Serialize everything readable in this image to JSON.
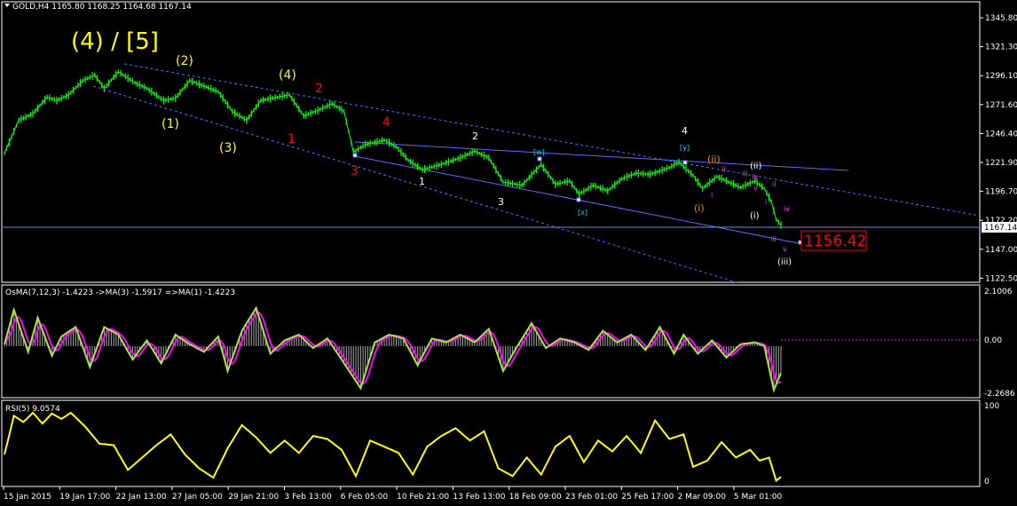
{
  "colors": {
    "background": "#000000",
    "frame": "#ffffff",
    "bull_candle": "#00ff00",
    "bear_candle": "#00ff00",
    "channel": "#5a6bff",
    "osma_hist": "#b4b4b4",
    "osma_fast": "#a7e34a",
    "osma_slow": "#ff00ff",
    "rsi": "#ffff00",
    "price_line": "#6f8fd6",
    "target_box": "#ff0000",
    "wave_yellow": "#ffff00",
    "wave_red": "#ff0000",
    "wave_white": "#ffffff",
    "wave_orange": "#ff8c00",
    "wave_cyan": "#00d5ff",
    "wave_magenta": "#ff33ff"
  },
  "main": {
    "title": "GOLD,H4  1165.80 1168.25 1164.68 1167.14",
    "price_axis": [
      "1345.80",
      "1321.30",
      "1296.10",
      "1271.60",
      "1246.40",
      "1221.90",
      "1196.70",
      "1172.20",
      "1147.00",
      "1122.50"
    ],
    "current_price": "1167.14",
    "target_label": "1156.42",
    "wave_labels": {
      "big": "(4) / [5]",
      "w1": "(1)",
      "w2": "(2)",
      "w3": "(3)",
      "w4": "(4)",
      "r1": "1",
      "r2": "2",
      "r3": "3",
      "r4": "4",
      "n1": "1",
      "n2": "2",
      "n3": "3",
      "n4": "4",
      "cw": "[w]",
      "cx": "[x]",
      "cy": "[y]",
      "oi": "(i)",
      "oii": "(ii)",
      "mi": "i",
      "mii": "ii",
      "miii": "iii",
      "miv": "iv",
      "mv": "v",
      "wi": "(i)",
      "wii": "(ii)",
      "wiii": "(iii)",
      "si": "i",
      "sii": "ii",
      "siii": "iii",
      "siv": "iv",
      "sv": "v"
    }
  },
  "osma": {
    "title": "OsMA(7,12,3) -1.4223  ->MA(3) -1.5917  =>MA(1) -1.4223",
    "axis": [
      "2.1006",
      "0.00",
      "-2.2686"
    ]
  },
  "rsi": {
    "title": "RSI(5) 9.0574",
    "axis": [
      "100",
      "0"
    ]
  },
  "time_axis": [
    "15 Jan 2015",
    "19 Jan 17:00",
    "22 Jan 13:00",
    "27 Jan 05:00",
    "29 Jan 21:00",
    "3 Feb 13:00",
    "6 Feb 05:00",
    "10 Feb 21:00",
    "13 Feb 13:00",
    "18 Feb 09:00",
    "23 Feb 01:00",
    "25 Feb 17:00",
    "2 Mar 09:00",
    "5 Mar 01:00"
  ],
  "chart_data": {
    "type": "line",
    "symbol": "GOLD",
    "timeframe": "H4",
    "ohlc_last": {
      "open": 1165.8,
      "high": 1168.25,
      "low": 1164.68,
      "close": 1167.14
    },
    "ylim": [
      1115,
      1355
    ],
    "close_path": [
      {
        "i": 0,
        "v": 1232
      },
      {
        "i": 6,
        "v": 1262
      },
      {
        "i": 12,
        "v": 1268
      },
      {
        "i": 18,
        "v": 1283
      },
      {
        "i": 22,
        "v": 1280
      },
      {
        "i": 27,
        "v": 1285
      },
      {
        "i": 33,
        "v": 1298
      },
      {
        "i": 38,
        "v": 1303
      },
      {
        "i": 42,
        "v": 1291
      },
      {
        "i": 48,
        "v": 1306
      },
      {
        "i": 55,
        "v": 1296
      },
      {
        "i": 60,
        "v": 1291
      },
      {
        "i": 67,
        "v": 1280
      },
      {
        "i": 72,
        "v": 1282
      },
      {
        "i": 78,
        "v": 1298
      },
      {
        "i": 84,
        "v": 1293
      },
      {
        "i": 90,
        "v": 1288
      },
      {
        "i": 96,
        "v": 1270
      },
      {
        "i": 102,
        "v": 1262
      },
      {
        "i": 108,
        "v": 1280
      },
      {
        "i": 115,
        "v": 1283
      },
      {
        "i": 120,
        "v": 1285
      },
      {
        "i": 126,
        "v": 1266
      },
      {
        "i": 132,
        "v": 1271
      },
      {
        "i": 138,
        "v": 1277
      },
      {
        "i": 143,
        "v": 1270
      },
      {
        "i": 147,
        "v": 1233
      },
      {
        "i": 152,
        "v": 1240
      },
      {
        "i": 160,
        "v": 1244
      },
      {
        "i": 165,
        "v": 1238
      },
      {
        "i": 170,
        "v": 1226
      },
      {
        "i": 176,
        "v": 1217
      },
      {
        "i": 184,
        "v": 1222
      },
      {
        "i": 192,
        "v": 1228
      },
      {
        "i": 198,
        "v": 1234
      },
      {
        "i": 204,
        "v": 1228
      },
      {
        "i": 210,
        "v": 1206
      },
      {
        "i": 218,
        "v": 1203
      },
      {
        "i": 226,
        "v": 1222
      },
      {
        "i": 232,
        "v": 1204
      },
      {
        "i": 238,
        "v": 1207
      },
      {
        "i": 242,
        "v": 1195
      },
      {
        "i": 248,
        "v": 1203
      },
      {
        "i": 254,
        "v": 1198
      },
      {
        "i": 260,
        "v": 1209
      },
      {
        "i": 266,
        "v": 1214
      },
      {
        "i": 272,
        "v": 1213
      },
      {
        "i": 280,
        "v": 1219
      },
      {
        "i": 284,
        "v": 1224
      },
      {
        "i": 290,
        "v": 1212
      },
      {
        "i": 294,
        "v": 1200
      },
      {
        "i": 300,
        "v": 1211
      },
      {
        "i": 304,
        "v": 1207
      },
      {
        "i": 310,
        "v": 1201
      },
      {
        "i": 316,
        "v": 1207
      },
      {
        "i": 320,
        "v": 1200
      },
      {
        "i": 323,
        "v": 1188
      },
      {
        "i": 325,
        "v": 1172
      },
      {
        "i": 327,
        "v": 1167
      }
    ],
    "osma_ylim": [
      -2.6,
      2.5
    ],
    "osma_path": [
      {
        "i": 0,
        "v": 0.1
      },
      {
        "i": 4,
        "v": 1.9
      },
      {
        "i": 10,
        "v": -0.3
      },
      {
        "i": 14,
        "v": 1.5
      },
      {
        "i": 20,
        "v": -0.5
      },
      {
        "i": 24,
        "v": 0.5
      },
      {
        "i": 30,
        "v": 1.0
      },
      {
        "i": 36,
        "v": -1.1
      },
      {
        "i": 42,
        "v": 1.0
      },
      {
        "i": 48,
        "v": 0.6
      },
      {
        "i": 54,
        "v": -0.7
      },
      {
        "i": 60,
        "v": 0.3
      },
      {
        "i": 66,
        "v": -0.9
      },
      {
        "i": 72,
        "v": 0.6
      },
      {
        "i": 78,
        "v": 0.1
      },
      {
        "i": 84,
        "v": -0.3
      },
      {
        "i": 90,
        "v": 0.5
      },
      {
        "i": 94,
        "v": -1.3
      },
      {
        "i": 100,
        "v": 0.8
      },
      {
        "i": 106,
        "v": 2.0
      },
      {
        "i": 112,
        "v": -0.4
      },
      {
        "i": 118,
        "v": 0.3
      },
      {
        "i": 124,
        "v": 0.6
      },
      {
        "i": 130,
        "v": -0.1
      },
      {
        "i": 136,
        "v": 0.4
      },
      {
        "i": 142,
        "v": -0.7
      },
      {
        "i": 150,
        "v": -2.2
      },
      {
        "i": 156,
        "v": 0.2
      },
      {
        "i": 162,
        "v": 0.6
      },
      {
        "i": 168,
        "v": 0.4
      },
      {
        "i": 174,
        "v": -1.0
      },
      {
        "i": 180,
        "v": 0.4
      },
      {
        "i": 186,
        "v": 0.2
      },
      {
        "i": 192,
        "v": 0.6
      },
      {
        "i": 198,
        "v": 0.2
      },
      {
        "i": 204,
        "v": 0.9
      },
      {
        "i": 210,
        "v": -1.3
      },
      {
        "i": 216,
        "v": 0.0
      },
      {
        "i": 222,
        "v": 1.2
      },
      {
        "i": 228,
        "v": -0.1
      },
      {
        "i": 234,
        "v": 0.4
      },
      {
        "i": 240,
        "v": 0.2
      },
      {
        "i": 246,
        "v": -0.2
      },
      {
        "i": 252,
        "v": 0.8
      },
      {
        "i": 258,
        "v": 0.2
      },
      {
        "i": 264,
        "v": 0.6
      },
      {
        "i": 270,
        "v": -0.2
      },
      {
        "i": 276,
        "v": 1.0
      },
      {
        "i": 282,
        "v": -0.4
      },
      {
        "i": 286,
        "v": 0.6
      },
      {
        "i": 292,
        "v": -0.4
      },
      {
        "i": 298,
        "v": 0.3
      },
      {
        "i": 304,
        "v": -0.6
      },
      {
        "i": 310,
        "v": 0.1
      },
      {
        "i": 316,
        "v": 0.2
      },
      {
        "i": 320,
        "v": 0.0
      },
      {
        "i": 324,
        "v": -2.3
      },
      {
        "i": 327,
        "v": -1.4
      }
    ],
    "rsi_ylim": [
      0,
      100
    ],
    "rsi_path": [
      {
        "i": 0,
        "v": 38
      },
      {
        "i": 4,
        "v": 88
      },
      {
        "i": 8,
        "v": 80
      },
      {
        "i": 12,
        "v": 92
      },
      {
        "i": 16,
        "v": 78
      },
      {
        "i": 20,
        "v": 91
      },
      {
        "i": 24,
        "v": 84
      },
      {
        "i": 28,
        "v": 92
      },
      {
        "i": 34,
        "v": 74
      },
      {
        "i": 40,
        "v": 52
      },
      {
        "i": 46,
        "v": 50
      },
      {
        "i": 52,
        "v": 18
      },
      {
        "i": 58,
        "v": 34
      },
      {
        "i": 64,
        "v": 50
      },
      {
        "i": 70,
        "v": 64
      },
      {
        "i": 76,
        "v": 38
      },
      {
        "i": 82,
        "v": 20
      },
      {
        "i": 88,
        "v": 8
      },
      {
        "i": 94,
        "v": 46
      },
      {
        "i": 100,
        "v": 76
      },
      {
        "i": 106,
        "v": 60
      },
      {
        "i": 112,
        "v": 40
      },
      {
        "i": 118,
        "v": 56
      },
      {
        "i": 124,
        "v": 40
      },
      {
        "i": 130,
        "v": 62
      },
      {
        "i": 136,
        "v": 58
      },
      {
        "i": 142,
        "v": 44
      },
      {
        "i": 148,
        "v": 10
      },
      {
        "i": 154,
        "v": 56
      },
      {
        "i": 160,
        "v": 48
      },
      {
        "i": 166,
        "v": 40
      },
      {
        "i": 172,
        "v": 12
      },
      {
        "i": 178,
        "v": 48
      },
      {
        "i": 184,
        "v": 62
      },
      {
        "i": 190,
        "v": 72
      },
      {
        "i": 196,
        "v": 56
      },
      {
        "i": 202,
        "v": 68
      },
      {
        "i": 208,
        "v": 20
      },
      {
        "i": 214,
        "v": 10
      },
      {
        "i": 220,
        "v": 34
      },
      {
        "i": 226,
        "v": 12
      },
      {
        "i": 232,
        "v": 48
      },
      {
        "i": 238,
        "v": 62
      },
      {
        "i": 244,
        "v": 28
      },
      {
        "i": 250,
        "v": 56
      },
      {
        "i": 256,
        "v": 42
      },
      {
        "i": 262,
        "v": 62
      },
      {
        "i": 268,
        "v": 40
      },
      {
        "i": 274,
        "v": 82
      },
      {
        "i": 280,
        "v": 58
      },
      {
        "i": 286,
        "v": 64
      },
      {
        "i": 290,
        "v": 22
      },
      {
        "i": 296,
        "v": 30
      },
      {
        "i": 302,
        "v": 54
      },
      {
        "i": 308,
        "v": 34
      },
      {
        "i": 314,
        "v": 44
      },
      {
        "i": 318,
        "v": 30
      },
      {
        "i": 322,
        "v": 34
      },
      {
        "i": 325,
        "v": 4
      },
      {
        "i": 327,
        "v": 9
      }
    ]
  }
}
